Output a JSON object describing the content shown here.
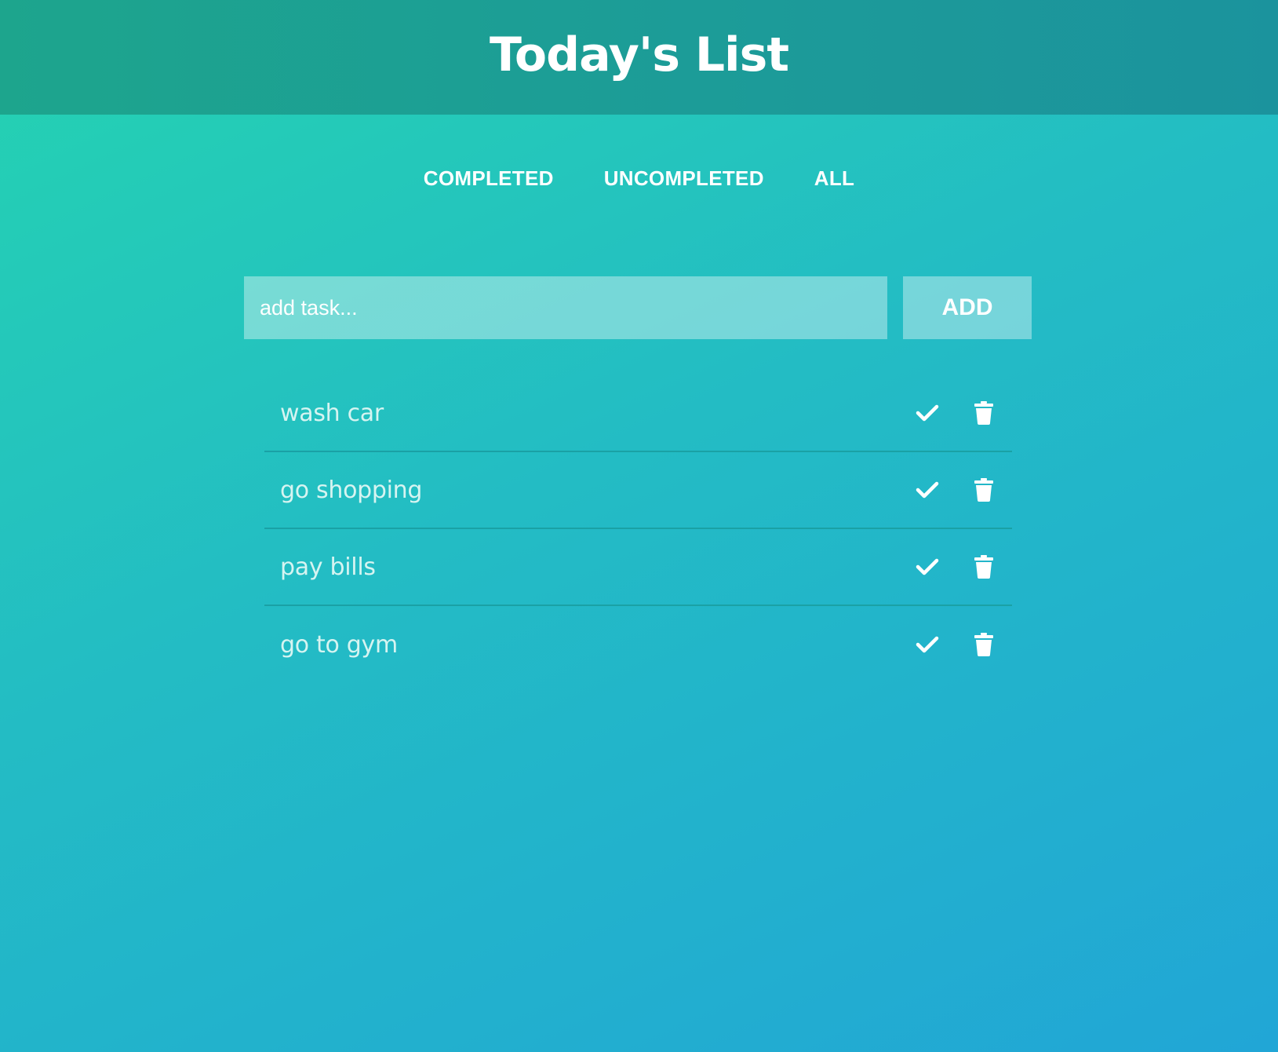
{
  "header": {
    "title": "Today's List"
  },
  "filters": {
    "completed": "COMPLETED",
    "uncompleted": "UNCOMPLETED",
    "all": "ALL"
  },
  "add_form": {
    "placeholder": "add task...",
    "value": "",
    "button_label": "ADD"
  },
  "tasks": [
    {
      "text": "wash car",
      "complete_icon": "check-icon",
      "delete_icon": "trash-icon"
    },
    {
      "text": "go shopping",
      "complete_icon": "check-icon",
      "delete_icon": "trash-icon"
    },
    {
      "text": "pay bills",
      "complete_icon": "check-icon",
      "delete_icon": "trash-icon"
    },
    {
      "text": "go to gym",
      "complete_icon": "check-icon",
      "delete_icon": "trash-icon"
    }
  ],
  "colors": {
    "header_background": "#1da58d",
    "page_gradient_start": "#25d3b1",
    "page_gradient_end": "#21a6d6",
    "divider": "#1aa1a5",
    "task_text": "#d6f4f1",
    "icon": "#ffffff"
  }
}
